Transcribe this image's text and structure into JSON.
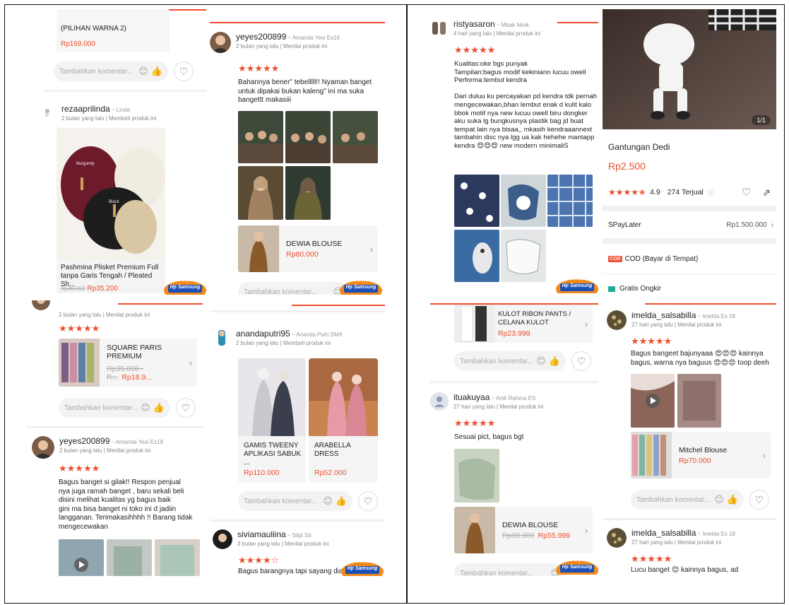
{
  "tiles": {
    "tl": {
      "product_prev_name": "(PILIHAN WARNA 2)",
      "product_prev_price": "Rp169.000",
      "comment_placeholder": "Tambahkan komentar...",
      "user": "rezaaprilinda",
      "user_sub": "~ Linda",
      "meta": "2 bulan yang lalu | Membeli produk ini",
      "product_name": "Pashmina Plisket Premium Full tanpa Garis Tengah / Pleated Sh...",
      "old_price": "Rp40.000",
      "price": "Rp35.200",
      "labels": [
        "Burgundy",
        "Black"
      ]
    },
    "tr": {
      "user": "yeyes200899",
      "user_sub": "~ Amanda Yesi Es18",
      "meta": "2 bulan yang lalu | Menilai produk ini",
      "stars": "★★★★★",
      "review": "Bahannya bener\" tebelllll!! Nyaman banget\nuntuk dipakai bukan kaleng\" ini ma suka\nbangettt makasiii",
      "product_name": "DEWIA BLOUSE",
      "price": "Rp80.000",
      "comment_placeholder": "Tambahkan komentar..."
    },
    "bl": {
      "meta_top": "2 bulan yang lalu | Menilai produk ini",
      "stars": "★★★★★",
      "product_name": "SQUARE PARIS PREMIUM",
      "old_price": "Rp35.000 - R...",
      "price": "Rp18.9...",
      "comment_placeholder": "Tambahkan komentar...",
      "user": "yeyes200899",
      "user_sub": "~ Amanda Yesi Es18",
      "meta": "2 bulan yang lalu | Menilai produk ini",
      "stars2": "★★★★★",
      "review": "Bagus banget si gilak!! Respon penjual\nnya juga ramah banget , baru sekali beli\ndisini melihat kualitas yg bagus baik\ngini ma bisa banget ni toko ini d jadiin\nlangganan. Terimakasihhhh !! Barang tidak\nmengecewakan"
    },
    "br": {
      "user": "anandaputri95",
      "user_sub": "~ Ananda Putri SMA",
      "meta": "2 bulan yang lalu | Membeli produk ini",
      "prod1_name": "GAMIS TWEENY APLIKASI SABUK ...",
      "prod1_price": "Rp110.000",
      "prod2_name": "ARABELLA DRESS",
      "prod2_price": "Rp52.000",
      "comment_placeholder": "Tambahkan komentar...",
      "user2": "siviamauliina",
      "user2_sub": "~ Silpi S4",
      "meta2": "3 bulan yang lalu | Menilai produk ini",
      "stars2": "★★★★☆",
      "review2": "Bagus barangnya tapi sayang diam"
    },
    "rtl": {
      "user": "ristyasaron",
      "user_sub": "~ Mbak Ninik",
      "meta": "4 hari yang lalu | Menilai produk ini",
      "stars": "★★★★★",
      "review": "Kualitas:oke bgs punyak\nTampilan:bagus modif kekiniann lucuu owell\nPerforma:lembut kendra\n\nDari duluu ku percayakan pd kendra tdk pernah\nmengecewakan,bhan lembut enak d kulit kalo\nbbok motif nya new lucuu owell biru dongker\naku suka lg bungkusnya plastik bag jd buat\ntempat lain nya bisaa,, mkasih kendraaannext\ntambahin disc nya lgg ua kak hehehe mantapp\nkendra 😍😍😍 new modern minimaliS"
    },
    "rtr": {
      "counter": "1/1",
      "product_name": "Gantungan Dedi",
      "price": "Rp2.500",
      "rating": "4.9",
      "sold": "274 Terjual",
      "spaylater_label": "SPayLater",
      "spaylater_value": "Rp1.500.000",
      "cod_badge": "COD",
      "cod_label": "COD (Bayar di Tempat)",
      "ongkir_label": "Gratis Ongkir"
    },
    "rbl": {
      "product_name": "KULOT RIBON PANTS / CELANA KULOT",
      "price": "Rp23.999",
      "comment_placeholder": "Tambahkan komentar...",
      "user": "ituakuyaa",
      "user_sub": "~ Anik Rahma ES",
      "meta": "27 hari yang lalu | Menilai produk ini",
      "stars": "★★★★★",
      "review": "Sesuai pict, bagus bgt",
      "product2_name": "DEWIA BLOUSE",
      "product2_old": "Rp80.000",
      "product2_price": "Rp55.999",
      "comment_placeholder2": "Tambahkan komentar..."
    },
    "rbr": {
      "user": "imelda_salsabilla",
      "user_sub": "~ Imelda Es 18",
      "meta": "27 hari yang lalu | Menilai produk ini",
      "stars": "★★★★★",
      "review": "Bagus bangeet bajunyaaa 😍😍😍 kainnya\nbagus, warna nya baguus 😍😍😍 toop deeh",
      "product_name": "Mitchel Blouse",
      "price": "Rp70.000",
      "comment_placeholder": "Tambahkan komentar...",
      "user2": "imelda_salsabilla",
      "user2_sub": "~ Imelda Es 18",
      "meta2": "27 hari yang lalu | Menilai produk ini",
      "stars2": "★★★★★",
      "review2": "Lucu banget 😊 kainnya bagus, ad"
    }
  },
  "badge": {
    "line1": "Menangkan",
    "line2": "Hp Samsung"
  },
  "colors": {
    "accent": "#ee4d2d",
    "star": "#ee4d2d"
  }
}
